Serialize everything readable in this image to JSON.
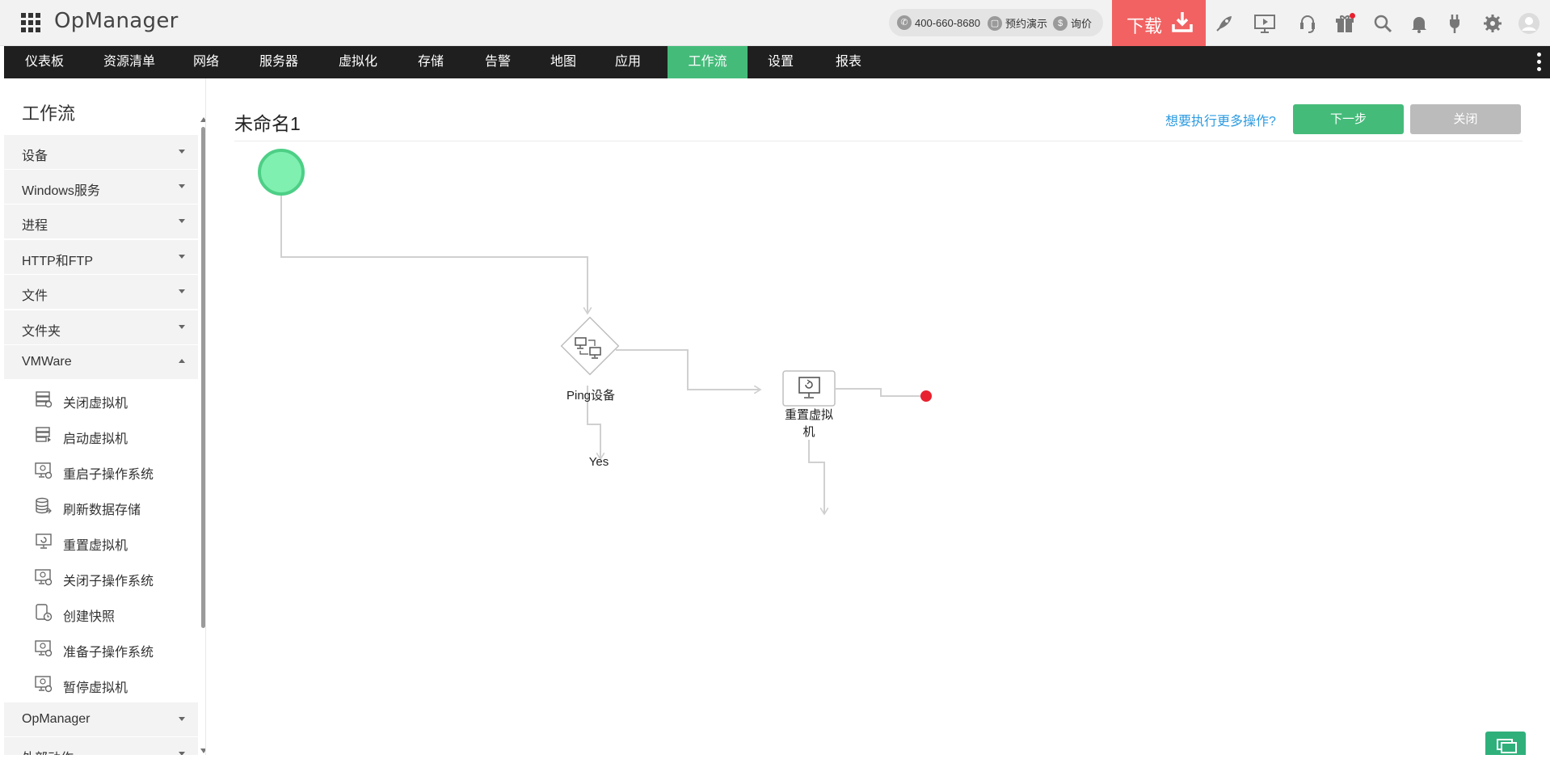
{
  "header": {
    "app_title": "OpManager",
    "phone": "400-660-8680",
    "demo_label": "预约演示",
    "price_label": "询价",
    "download_label": "下载"
  },
  "nav": {
    "items": [
      {
        "label": "仪表板"
      },
      {
        "label": "资源清单"
      },
      {
        "label": "网络"
      },
      {
        "label": "服务器"
      },
      {
        "label": "虚拟化"
      },
      {
        "label": "存储"
      },
      {
        "label": "告警"
      },
      {
        "label": "地图"
      },
      {
        "label": "应用"
      },
      {
        "label": "工作流",
        "active": true
      },
      {
        "label": "设置"
      },
      {
        "label": "报表"
      }
    ],
    "active_color": "#45bb7a"
  },
  "sidebar": {
    "title": "工作流",
    "categories": [
      {
        "label": "设备",
        "expanded": false
      },
      {
        "label": "Windows服务",
        "expanded": false
      },
      {
        "label": "进程",
        "expanded": false
      },
      {
        "label": "HTTP和FTP",
        "expanded": false
      },
      {
        "label": "文件",
        "expanded": false
      },
      {
        "label": "文件夹",
        "expanded": false
      },
      {
        "label": "VMWare",
        "expanded": true
      },
      {
        "label": "OpManager",
        "expanded": false
      },
      {
        "label": "外部动作",
        "expanded": false
      }
    ],
    "vmware_actions": [
      {
        "label": "关闭虚拟机",
        "icon": "server-power-icon"
      },
      {
        "label": "启动虚拟机",
        "icon": "server-start-icon"
      },
      {
        "label": "重启子操作系统",
        "icon": "monitor-restart-icon"
      },
      {
        "label": "刷新数据存储",
        "icon": "database-refresh-icon"
      },
      {
        "label": "重置虚拟机",
        "icon": "monitor-reset-icon"
      },
      {
        "label": "关闭子操作系统",
        "icon": "monitor-shutdown-icon"
      },
      {
        "label": "创建快照",
        "icon": "snapshot-clock-icon"
      },
      {
        "label": "准备子操作系统",
        "icon": "monitor-standby-icon"
      },
      {
        "label": "暂停虚拟机",
        "icon": "monitor-pause-icon"
      }
    ]
  },
  "main": {
    "workflow_name": "未命名1",
    "more_actions_link": "想要执行更多操作?",
    "next_button": "下一步",
    "close_button": "关闭"
  },
  "workflow": {
    "nodes": [
      {
        "id": "start",
        "type": "start",
        "label": ""
      },
      {
        "id": "ping",
        "type": "condition",
        "label": "Ping设备"
      },
      {
        "id": "reset",
        "type": "action",
        "label": "重置虚拟机"
      },
      {
        "id": "end",
        "type": "end",
        "label": ""
      }
    ],
    "branch_labels": {
      "yes": "Yes"
    },
    "colors": {
      "start_fill": "#7ff0b0",
      "start_stroke": "#4dcf86",
      "end": "#e8212e",
      "connector": "#cfcfcf"
    }
  }
}
